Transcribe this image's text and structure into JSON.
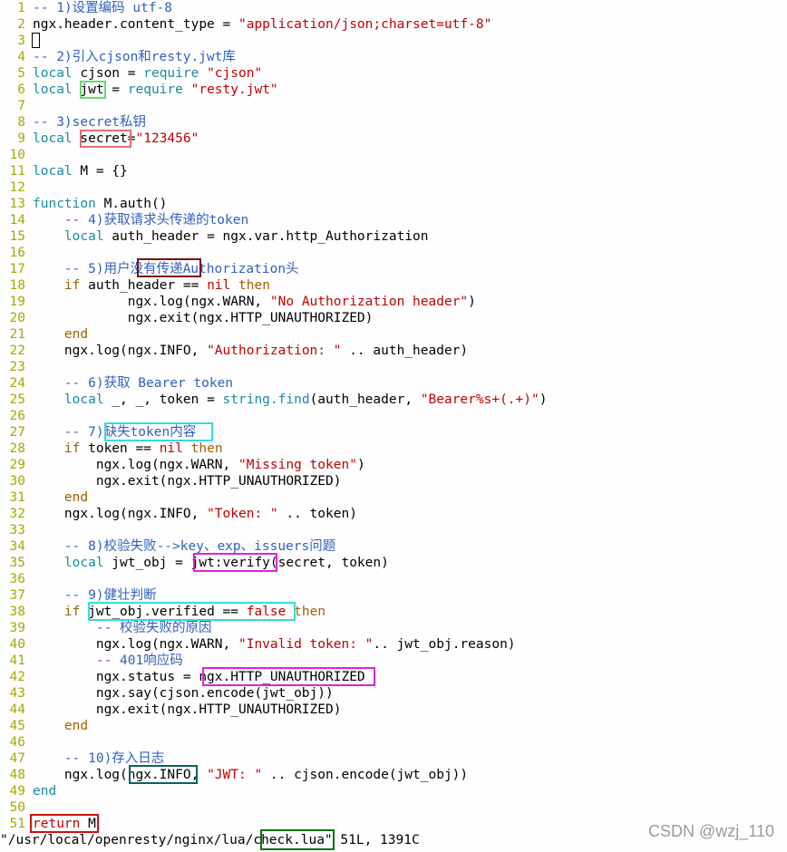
{
  "editor": {
    "lines": [
      {
        "n": "1",
        "segs": [
          {
            "t": "-- 1)设置编码 utf-8",
            "c": "c"
          }
        ]
      },
      {
        "n": "2",
        "segs": [
          {
            "t": "ngx.header.content_type = ",
            "c": "n"
          },
          {
            "t": "\"application/json;charset=utf-8\"",
            "c": "s"
          }
        ]
      },
      {
        "n": "3",
        "segs": []
      },
      {
        "n": "4",
        "segs": [
          {
            "t": "-- 2)引入cjson和resty.jwt库",
            "c": "c"
          }
        ]
      },
      {
        "n": "5",
        "segs": [
          {
            "t": "local",
            "c": "b"
          },
          {
            "t": " cjson = ",
            "c": "n"
          },
          {
            "t": "require",
            "c": "b"
          },
          {
            "t": " ",
            "c": "n"
          },
          {
            "t": "\"cjson\"",
            "c": "s"
          }
        ]
      },
      {
        "n": "6",
        "segs": [
          {
            "t": "local",
            "c": "b"
          },
          {
            "t": " jwt = ",
            "c": "n"
          },
          {
            "t": "require",
            "c": "b"
          },
          {
            "t": " ",
            "c": "n"
          },
          {
            "t": "\"resty.jwt\"",
            "c": "s"
          }
        ]
      },
      {
        "n": "7",
        "segs": []
      },
      {
        "n": "8",
        "segs": [
          {
            "t": "-- 3)secret私钥",
            "c": "c"
          }
        ]
      },
      {
        "n": "9",
        "segs": [
          {
            "t": "local",
            "c": "b"
          },
          {
            "t": " secret=",
            "c": "n"
          },
          {
            "t": "\"123456\"",
            "c": "s"
          }
        ]
      },
      {
        "n": "10",
        "segs": []
      },
      {
        "n": "11",
        "segs": [
          {
            "t": "local",
            "c": "b"
          },
          {
            "t": " M = {}",
            "c": "n"
          }
        ]
      },
      {
        "n": "12",
        "segs": []
      },
      {
        "n": "13",
        "segs": [
          {
            "t": "function",
            "c": "b"
          },
          {
            "t": " M.auth()",
            "c": "n"
          }
        ]
      },
      {
        "n": "14",
        "segs": [
          {
            "t": "    -- 4)获取请求头传递的token",
            "c": "c"
          }
        ]
      },
      {
        "n": "15",
        "segs": [
          {
            "t": "    ",
            "c": "n"
          },
          {
            "t": "local",
            "c": "b"
          },
          {
            "t": " auth_header = ngx.var.http_Authorization",
            "c": "n"
          }
        ]
      },
      {
        "n": "16",
        "segs": []
      },
      {
        "n": "17",
        "segs": [
          {
            "t": "    -- 5)用户没有传递Authorization头",
            "c": "c"
          }
        ]
      },
      {
        "n": "18",
        "segs": [
          {
            "t": "    ",
            "c": "n"
          },
          {
            "t": "if",
            "c": "k"
          },
          {
            "t": " auth_header == ",
            "c": "n"
          },
          {
            "t": "nil",
            "c": "s"
          },
          {
            "t": " ",
            "c": "n"
          },
          {
            "t": "then",
            "c": "k"
          }
        ]
      },
      {
        "n": "19",
        "segs": [
          {
            "t": "            ngx.log(ngx.WARN, ",
            "c": "n"
          },
          {
            "t": "\"No Authorization header\"",
            "c": "s"
          },
          {
            "t": ")",
            "c": "n"
          }
        ]
      },
      {
        "n": "20",
        "segs": [
          {
            "t": "            ngx.exit(ngx.HTTP_UNAUTHORIZED)",
            "c": "n"
          }
        ]
      },
      {
        "n": "21",
        "segs": [
          {
            "t": "    ",
            "c": "n"
          },
          {
            "t": "end",
            "c": "k"
          }
        ]
      },
      {
        "n": "22",
        "segs": [
          {
            "t": "    ngx.log(ngx.INFO, ",
            "c": "n"
          },
          {
            "t": "\"Authorization: \"",
            "c": "s"
          },
          {
            "t": " .. auth_header)",
            "c": "n"
          }
        ]
      },
      {
        "n": "23",
        "segs": []
      },
      {
        "n": "24",
        "segs": [
          {
            "t": "    -- 6)获取 Bearer token",
            "c": "c"
          }
        ]
      },
      {
        "n": "25",
        "segs": [
          {
            "t": "    ",
            "c": "n"
          },
          {
            "t": "local",
            "c": "b"
          },
          {
            "t": " _, _, token = ",
            "c": "n"
          },
          {
            "t": "string.find",
            "c": "b"
          },
          {
            "t": "(auth_header, ",
            "c": "n"
          },
          {
            "t": "\"Bearer%s+(.+)\"",
            "c": "s"
          },
          {
            "t": ")",
            "c": "n"
          }
        ]
      },
      {
        "n": "26",
        "segs": []
      },
      {
        "n": "27",
        "segs": [
          {
            "t": "    -- 7)缺失token内容",
            "c": "c"
          }
        ]
      },
      {
        "n": "28",
        "segs": [
          {
            "t": "    ",
            "c": "n"
          },
          {
            "t": "if",
            "c": "k"
          },
          {
            "t": " token == ",
            "c": "n"
          },
          {
            "t": "nil",
            "c": "s"
          },
          {
            "t": " ",
            "c": "n"
          },
          {
            "t": "then",
            "c": "k"
          }
        ]
      },
      {
        "n": "29",
        "segs": [
          {
            "t": "        ngx.log(ngx.WARN, ",
            "c": "n"
          },
          {
            "t": "\"Missing token\"",
            "c": "s"
          },
          {
            "t": ")",
            "c": "n"
          }
        ]
      },
      {
        "n": "30",
        "segs": [
          {
            "t": "        ngx.exit(ngx.HTTP_UNAUTHORIZED)",
            "c": "n"
          }
        ]
      },
      {
        "n": "31",
        "segs": [
          {
            "t": "    ",
            "c": "n"
          },
          {
            "t": "end",
            "c": "k"
          }
        ]
      },
      {
        "n": "32",
        "segs": [
          {
            "t": "    ngx.log(ngx.INFO, ",
            "c": "n"
          },
          {
            "t": "\"Token: \"",
            "c": "s"
          },
          {
            "t": " .. token)",
            "c": "n"
          }
        ]
      },
      {
        "n": "33",
        "segs": []
      },
      {
        "n": "34",
        "segs": [
          {
            "t": "    -- 8)校验失败-->key、exp、issuers问题",
            "c": "c"
          }
        ]
      },
      {
        "n": "35",
        "segs": [
          {
            "t": "    ",
            "c": "n"
          },
          {
            "t": "local",
            "c": "b"
          },
          {
            "t": " jwt_obj = jwt:verify(secret, token)",
            "c": "n"
          }
        ]
      },
      {
        "n": "36",
        "segs": []
      },
      {
        "n": "37",
        "segs": [
          {
            "t": "    -- 9)健壮判断",
            "c": "c"
          }
        ]
      },
      {
        "n": "38",
        "segs": [
          {
            "t": "    ",
            "c": "n"
          },
          {
            "t": "if",
            "c": "k"
          },
          {
            "t": " jwt_obj.verified == ",
            "c": "n"
          },
          {
            "t": "false",
            "c": "s"
          },
          {
            "t": " ",
            "c": "n"
          },
          {
            "t": "then",
            "c": "k"
          }
        ]
      },
      {
        "n": "39",
        "segs": [
          {
            "t": "        -- 校验失败的原因",
            "c": "c"
          }
        ]
      },
      {
        "n": "40",
        "segs": [
          {
            "t": "        ngx.log(ngx.WARN, ",
            "c": "n"
          },
          {
            "t": "\"Invalid token: \"",
            "c": "s"
          },
          {
            "t": ".. jwt_obj.reason)",
            "c": "n"
          }
        ]
      },
      {
        "n": "41",
        "segs": [
          {
            "t": "        -- 401响应码",
            "c": "c"
          }
        ]
      },
      {
        "n": "42",
        "segs": [
          {
            "t": "        ngx.status = ngx.HTTP_UNAUTHORIZED",
            "c": "n"
          }
        ]
      },
      {
        "n": "43",
        "segs": [
          {
            "t": "        ngx.say(cjson.encode(jwt_obj))",
            "c": "n"
          }
        ]
      },
      {
        "n": "44",
        "segs": [
          {
            "t": "        ngx.exit(ngx.HTTP_UNAUTHORIZED)",
            "c": "n"
          }
        ]
      },
      {
        "n": "45",
        "segs": [
          {
            "t": "    ",
            "c": "n"
          },
          {
            "t": "end",
            "c": "k"
          }
        ]
      },
      {
        "n": "46",
        "segs": []
      },
      {
        "n": "47",
        "segs": [
          {
            "t": "    -- 10)存入日志",
            "c": "c"
          }
        ]
      },
      {
        "n": "48",
        "segs": [
          {
            "t": "    ngx.log(ngx.INFO, ",
            "c": "n"
          },
          {
            "t": "\"JWT: \"",
            "c": "s"
          },
          {
            "t": " .. cjson.encode(jwt_obj))",
            "c": "n"
          }
        ]
      },
      {
        "n": "49",
        "segs": [
          {
            "t": "end",
            "c": "b"
          }
        ]
      },
      {
        "n": "50",
        "segs": []
      },
      {
        "n": "51",
        "segs": [
          {
            "t": "return",
            "c": "s"
          },
          {
            "t": " M",
            "c": "n"
          }
        ]
      }
    ]
  },
  "status_line": "\"/usr/local/openresty/nginx/lua/check.lua\" 51L, 1391C",
  "watermark": "CSDN @wzj_110",
  "colors": {
    "box_green": "#66dd66",
    "box_pink": "#e07070",
    "box_maroon": "#7a1010",
    "box_cyan": "#33dddd",
    "box_magenta": "#dd22dd",
    "box_teal": "#106060",
    "box_red": "#cc1111",
    "box_darkgreen": "#107010"
  }
}
